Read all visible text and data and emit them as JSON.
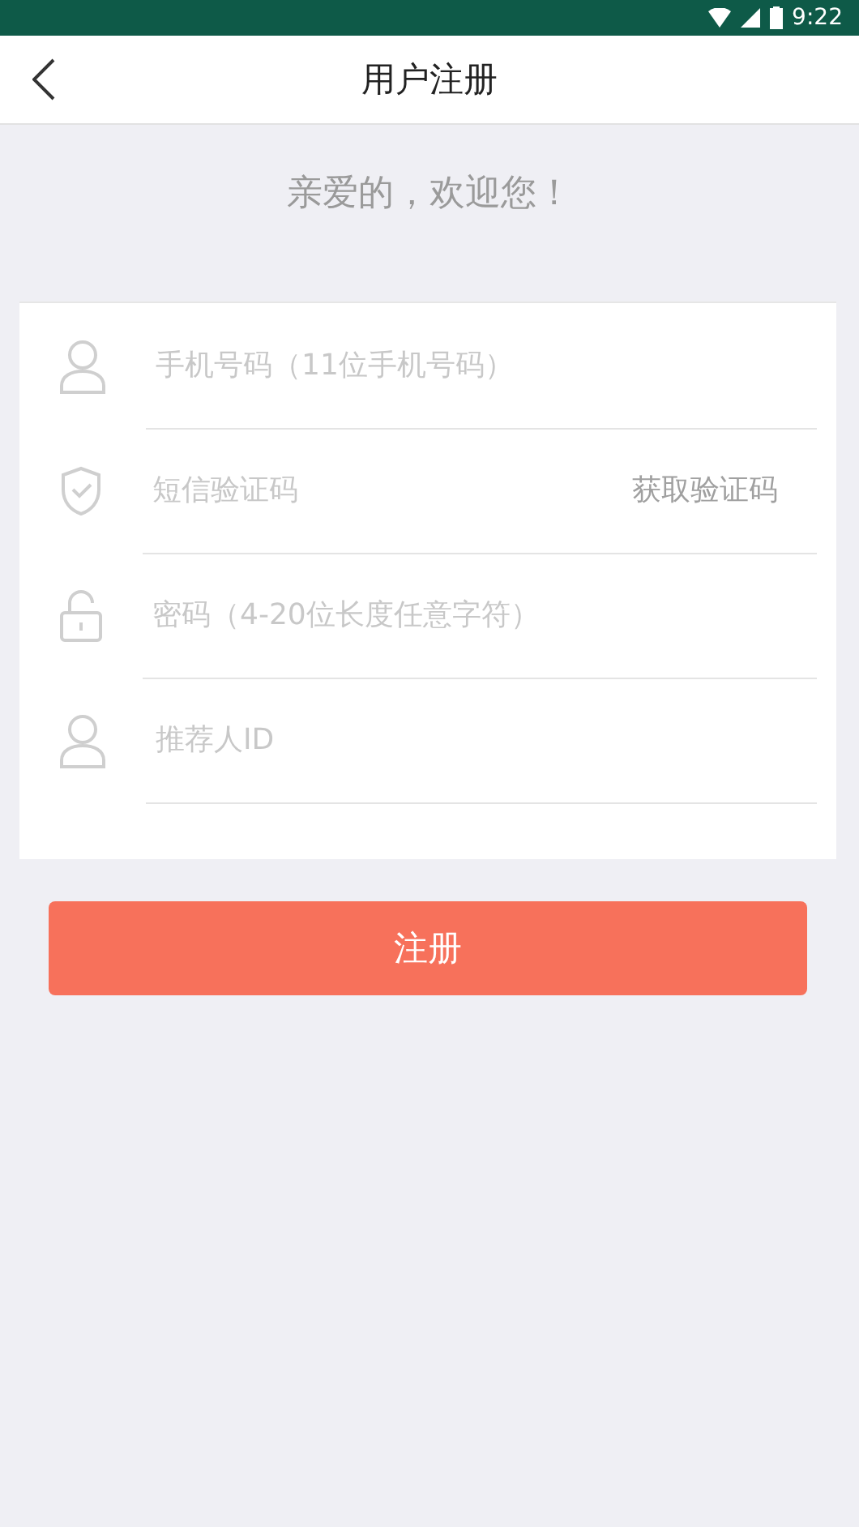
{
  "status_bar": {
    "time": "9:22"
  },
  "header": {
    "title": "用户注册"
  },
  "greeting": "亲爱的，欢迎您！",
  "fields": [
    {
      "kind": "person",
      "placeholder": "手机号码（11位手机号码）"
    },
    {
      "kind": "shield",
      "placeholder": "短信验证码",
      "action": "获取验证码"
    },
    {
      "kind": "lock",
      "placeholder": "密码（4-20位长度任意字符）"
    },
    {
      "kind": "person",
      "placeholder": "推荐人ID"
    }
  ],
  "submit": "注册"
}
